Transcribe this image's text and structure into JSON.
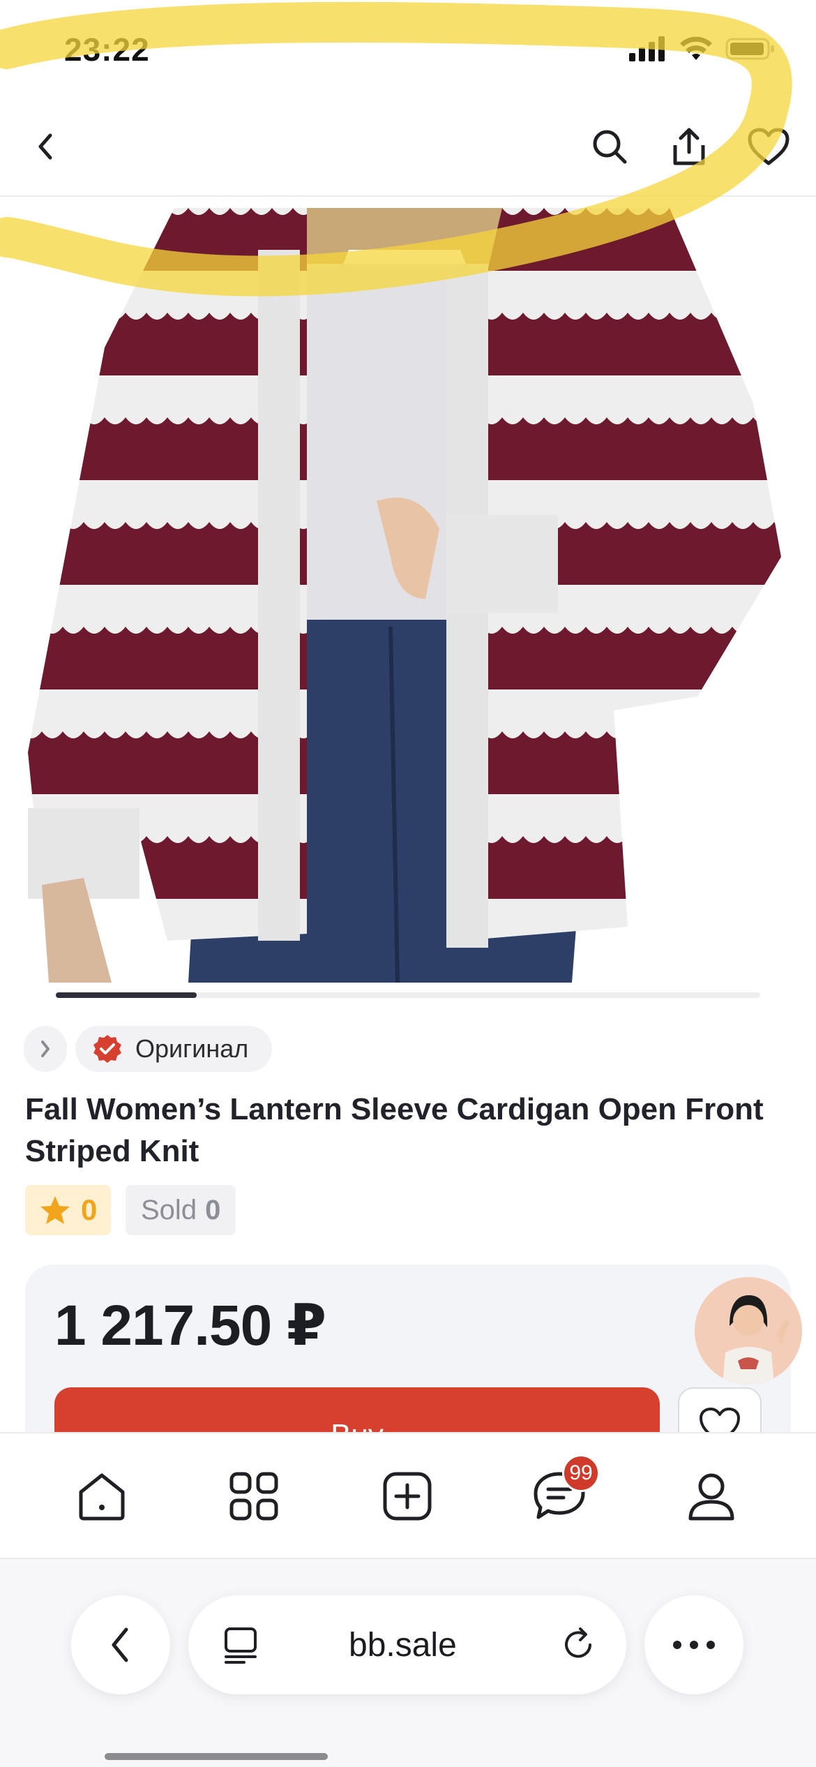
{
  "status_bar": {
    "time": "23:22"
  },
  "header": {
    "back_icon": "chevron-left-icon",
    "search_icon": "search-icon",
    "share_icon": "share-icon",
    "favorite_icon": "heart-icon"
  },
  "product": {
    "original_label": "Оригинал",
    "title": "Fall Women’s Lantern Sleeve Cardigan Open Front Striped Knit",
    "rating": "0",
    "sold_label": "Sold",
    "sold_count": "0",
    "price": "1 217.50 ₽",
    "buy_label": "Buy",
    "carousel": {
      "active_index": 1,
      "fraction_shown": 0.2
    }
  },
  "tabbar": {
    "items": [
      {
        "name": "home-icon"
      },
      {
        "name": "catalog-icon"
      },
      {
        "name": "add-icon"
      },
      {
        "name": "chat-icon"
      },
      {
        "name": "profile-icon"
      }
    ],
    "chat_badge": "99"
  },
  "browser": {
    "url": "bb.sale"
  },
  "colors": {
    "accent": "#d6402f",
    "star": "#f1a51c",
    "cardigan": "#6e1a2e",
    "highlight": "#f5d63b"
  }
}
